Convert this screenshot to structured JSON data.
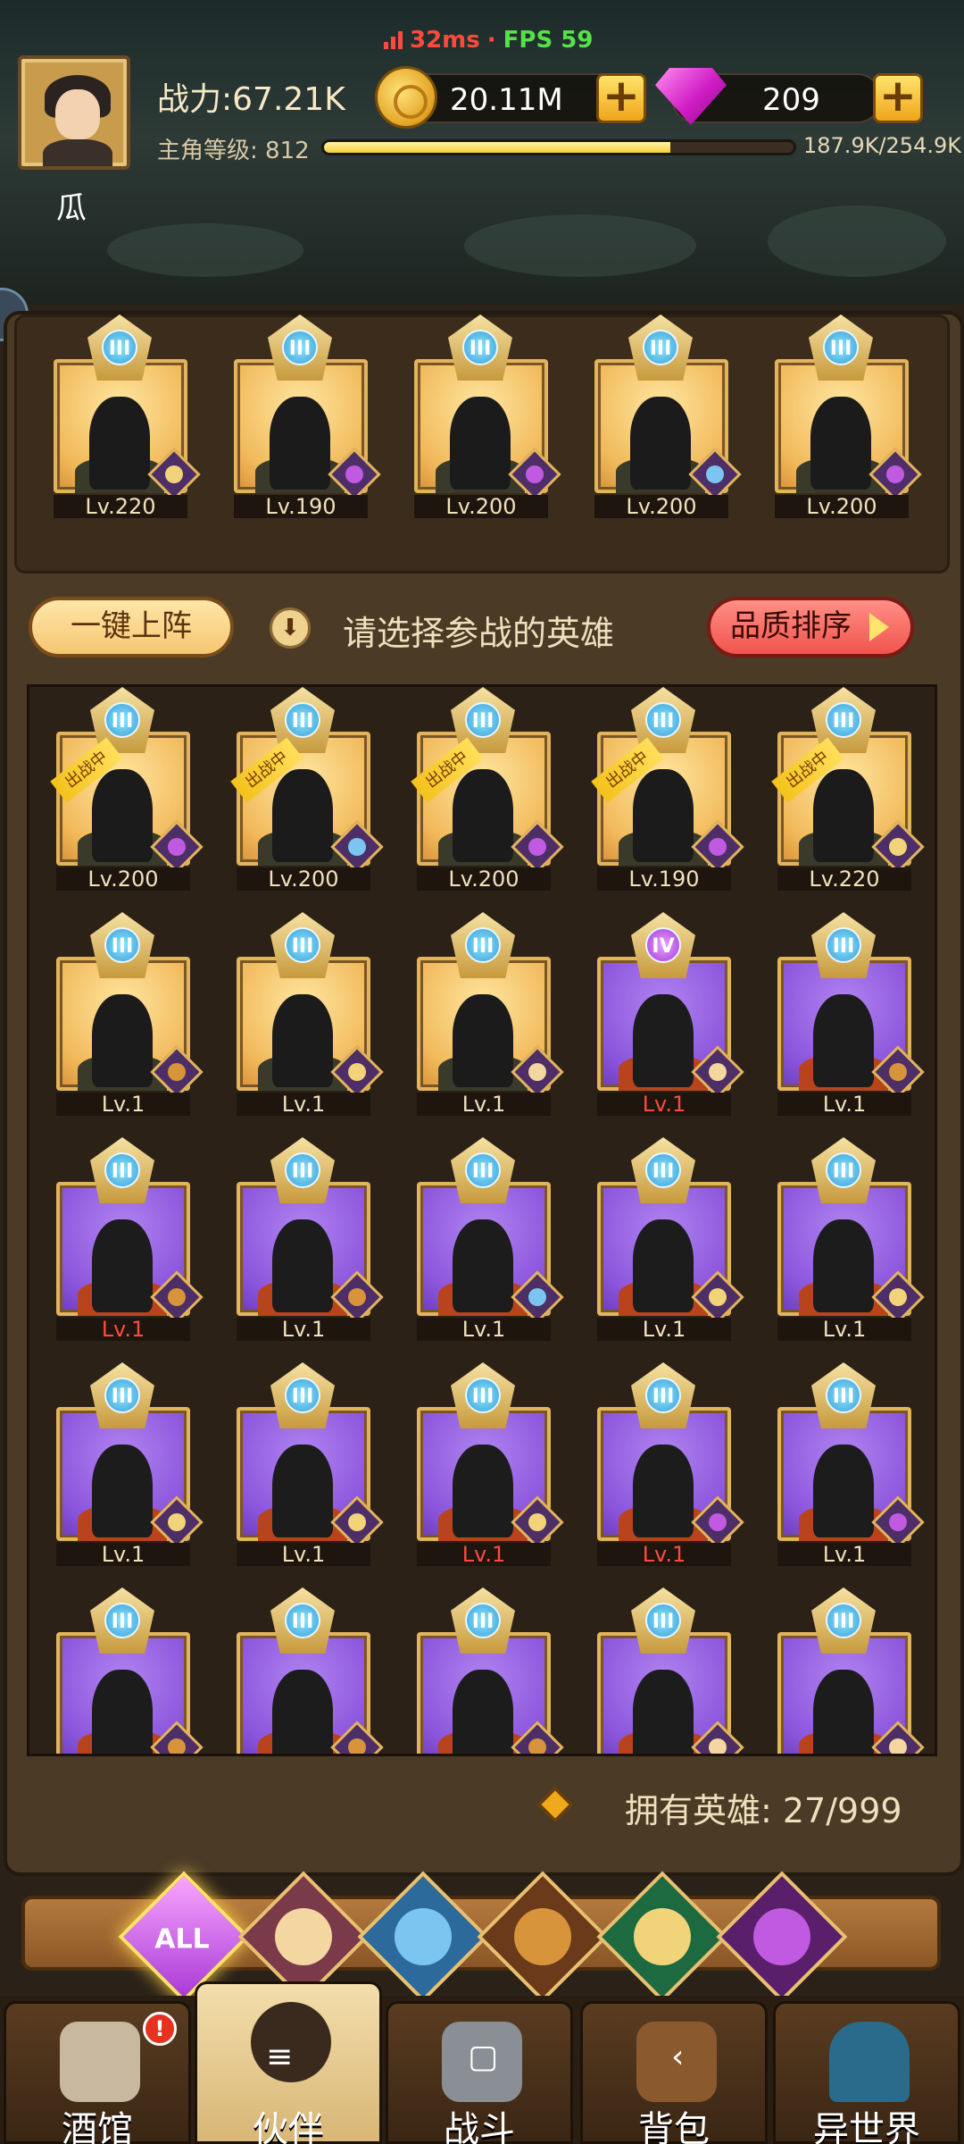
{
  "status": {
    "latency": "32ms",
    "separator": "·",
    "fps": "FPS 59"
  },
  "player": {
    "name": "瓜",
    "power_label": "战力:67.21K",
    "level_label": "主角等级: 812",
    "exp_text": "187.9K/254.9K",
    "exp_fraction": 0.737,
    "gold": "20.11M",
    "gems": "209"
  },
  "lineup": [
    {
      "level": "Lv.220",
      "rank": "III",
      "theme": "gold",
      "faction": "elf"
    },
    {
      "level": "Lv.190",
      "rank": "III",
      "theme": "gold",
      "faction": "demon"
    },
    {
      "level": "Lv.200",
      "rank": "III",
      "theme": "gold",
      "faction": "demon"
    },
    {
      "level": "Lv.200",
      "rank": "III",
      "theme": "gold",
      "faction": "ocean"
    },
    {
      "level": "Lv.200",
      "rank": "III",
      "theme": "gold",
      "faction": "demon"
    }
  ],
  "actions": {
    "auto_deploy": "一键上阵",
    "select_prompt": "请选择参战的英雄",
    "sort": "品质排序"
  },
  "heroes": [
    {
      "level": "Lv.200",
      "rank": "III",
      "theme": "gold",
      "faction": "demon",
      "deployed": true,
      "red": false
    },
    {
      "level": "Lv.200",
      "rank": "III",
      "theme": "gold",
      "faction": "ocean",
      "deployed": true,
      "red": false
    },
    {
      "level": "Lv.200",
      "rank": "III",
      "theme": "gold",
      "faction": "demon",
      "deployed": true,
      "red": false
    },
    {
      "level": "Lv.190",
      "rank": "III",
      "theme": "gold",
      "faction": "demon",
      "deployed": true,
      "red": false
    },
    {
      "level": "Lv.220",
      "rank": "III",
      "theme": "gold",
      "faction": "elf",
      "deployed": true,
      "red": false
    },
    {
      "level": "Lv.1",
      "rank": "III",
      "theme": "gold",
      "faction": "beast",
      "deployed": false,
      "red": false
    },
    {
      "level": "Lv.1",
      "rank": "III",
      "theme": "gold",
      "faction": "elf",
      "deployed": false,
      "red": false
    },
    {
      "level": "Lv.1",
      "rank": "III",
      "theme": "gold",
      "faction": "holy",
      "deployed": false,
      "red": false
    },
    {
      "level": "Lv.1",
      "rank": "IV",
      "theme": "purple",
      "faction": "holy",
      "deployed": false,
      "red": true
    },
    {
      "level": "Lv.1",
      "rank": "III",
      "theme": "purple",
      "faction": "beast",
      "deployed": false,
      "red": false
    },
    {
      "level": "Lv.1",
      "rank": "III",
      "theme": "purple",
      "faction": "beast",
      "deployed": false,
      "red": true
    },
    {
      "level": "Lv.1",
      "rank": "III",
      "theme": "purple",
      "faction": "beast",
      "deployed": false,
      "red": false
    },
    {
      "level": "Lv.1",
      "rank": "III",
      "theme": "purple",
      "faction": "ocean",
      "deployed": false,
      "red": false
    },
    {
      "level": "Lv.1",
      "rank": "III",
      "theme": "purple",
      "faction": "elf",
      "deployed": false,
      "red": false
    },
    {
      "level": "Lv.1",
      "rank": "III",
      "theme": "purple",
      "faction": "elf",
      "deployed": false,
      "red": false
    },
    {
      "level": "Lv.1",
      "rank": "III",
      "theme": "purple",
      "faction": "elf",
      "deployed": false,
      "red": false
    },
    {
      "level": "Lv.1",
      "rank": "III",
      "theme": "purple",
      "faction": "elf",
      "deployed": false,
      "red": false
    },
    {
      "level": "Lv.1",
      "rank": "III",
      "theme": "purple",
      "faction": "elf",
      "deployed": false,
      "red": true
    },
    {
      "level": "Lv.1",
      "rank": "III",
      "theme": "purple",
      "faction": "demon",
      "deployed": false,
      "red": true
    },
    {
      "level": "Lv.1",
      "rank": "III",
      "theme": "purple",
      "faction": "demon",
      "deployed": false,
      "red": false
    },
    {
      "level": "",
      "rank": "III",
      "theme": "purple",
      "faction": "beast",
      "deployed": false,
      "red": false
    },
    {
      "level": "",
      "rank": "III",
      "theme": "purple",
      "faction": "beast",
      "deployed": false,
      "red": false
    },
    {
      "level": "",
      "rank": "III",
      "theme": "purple",
      "faction": "beast",
      "deployed": false,
      "red": false
    },
    {
      "level": "",
      "rank": "III",
      "theme": "purple",
      "faction": "holy",
      "deployed": false,
      "red": false
    },
    {
      "level": "",
      "rank": "III",
      "theme": "purple",
      "faction": "holy",
      "deployed": false,
      "red": false
    }
  ],
  "deployed_label": "出战中",
  "hero_count": "拥有英雄: 27/999",
  "filters": {
    "all_label": "ALL",
    "icons": [
      "holy-icon",
      "ocean-icon",
      "beast-icon",
      "elf-icon",
      "demon-icon"
    ]
  },
  "nav": {
    "tavern": "酒馆",
    "partner": "伙伴",
    "battle": "战斗",
    "bag": "背包",
    "otherworld": "异世界",
    "tavern_badge": "!"
  },
  "colors": {
    "accent_gold": "#f0b83c",
    "purple_card": "#8b55dc",
    "gold_card": "#f1b95a",
    "red_level": "#ff4a3d",
    "fps_green": "#56e04a"
  }
}
